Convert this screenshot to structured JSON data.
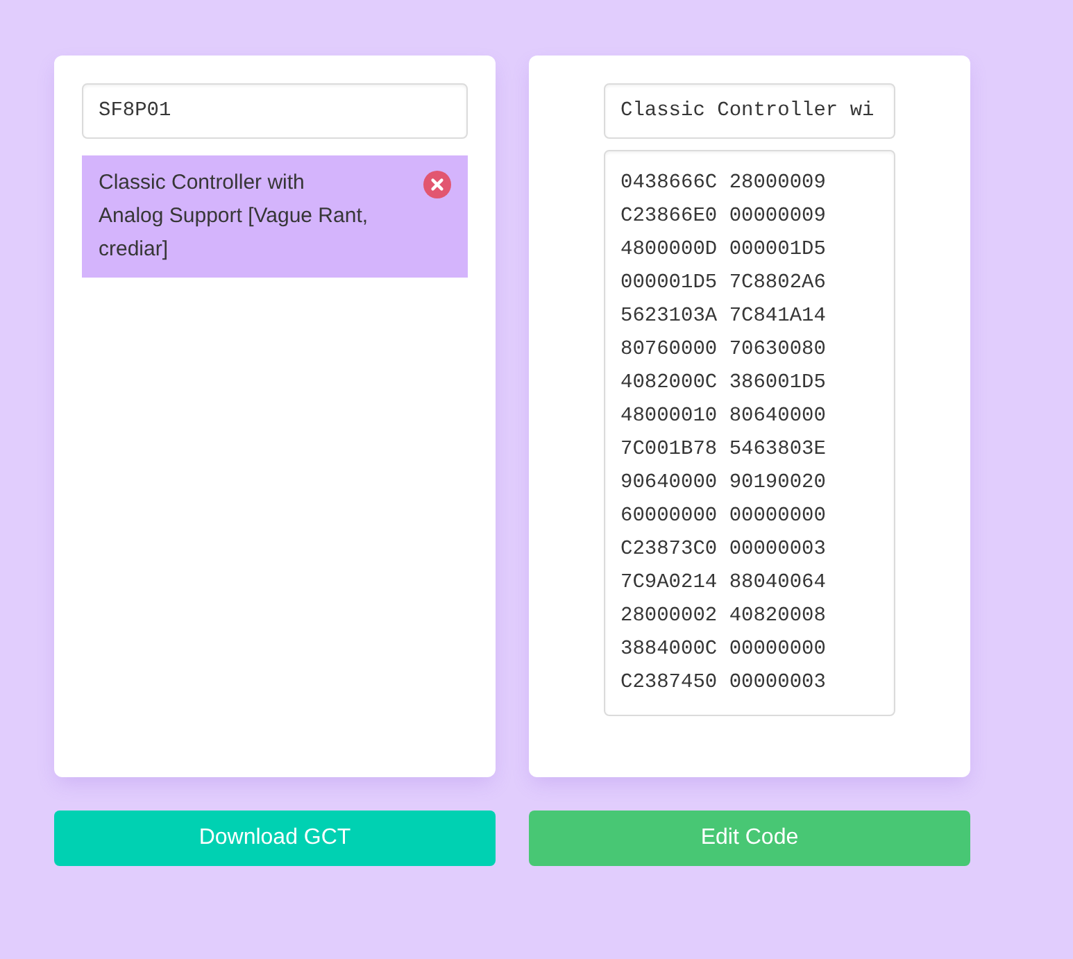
{
  "left_panel": {
    "game_id_field": {
      "value": "SF8P01"
    },
    "codes": [
      {
        "title": "Classic Controller with Analog Support [Vague Rant, crediar]",
        "selected": true
      }
    ]
  },
  "right_panel": {
    "code_name_field": {
      "value": "Classic Controller wi"
    },
    "code_lines": [
      "0438666C 28000009",
      "C23866E0 00000009",
      "4800000D 000001D5",
      "000001D5 7C8802A6",
      "5623103A 7C841A14",
      "80760000 70630080",
      "4082000C 386001D5",
      "48000010 80640000",
      "7C001B78 5463803E",
      "90640000 90190020",
      "60000000 00000000",
      "C23873C0 00000003",
      "7C9A0214 88040064",
      "28000002 40820008",
      "3884000C 00000000",
      "C2387450 00000003"
    ]
  },
  "buttons": [
    {
      "label": "Download GCT",
      "kind": "primary"
    },
    {
      "label": "Edit Code",
      "kind": "success"
    }
  ]
}
